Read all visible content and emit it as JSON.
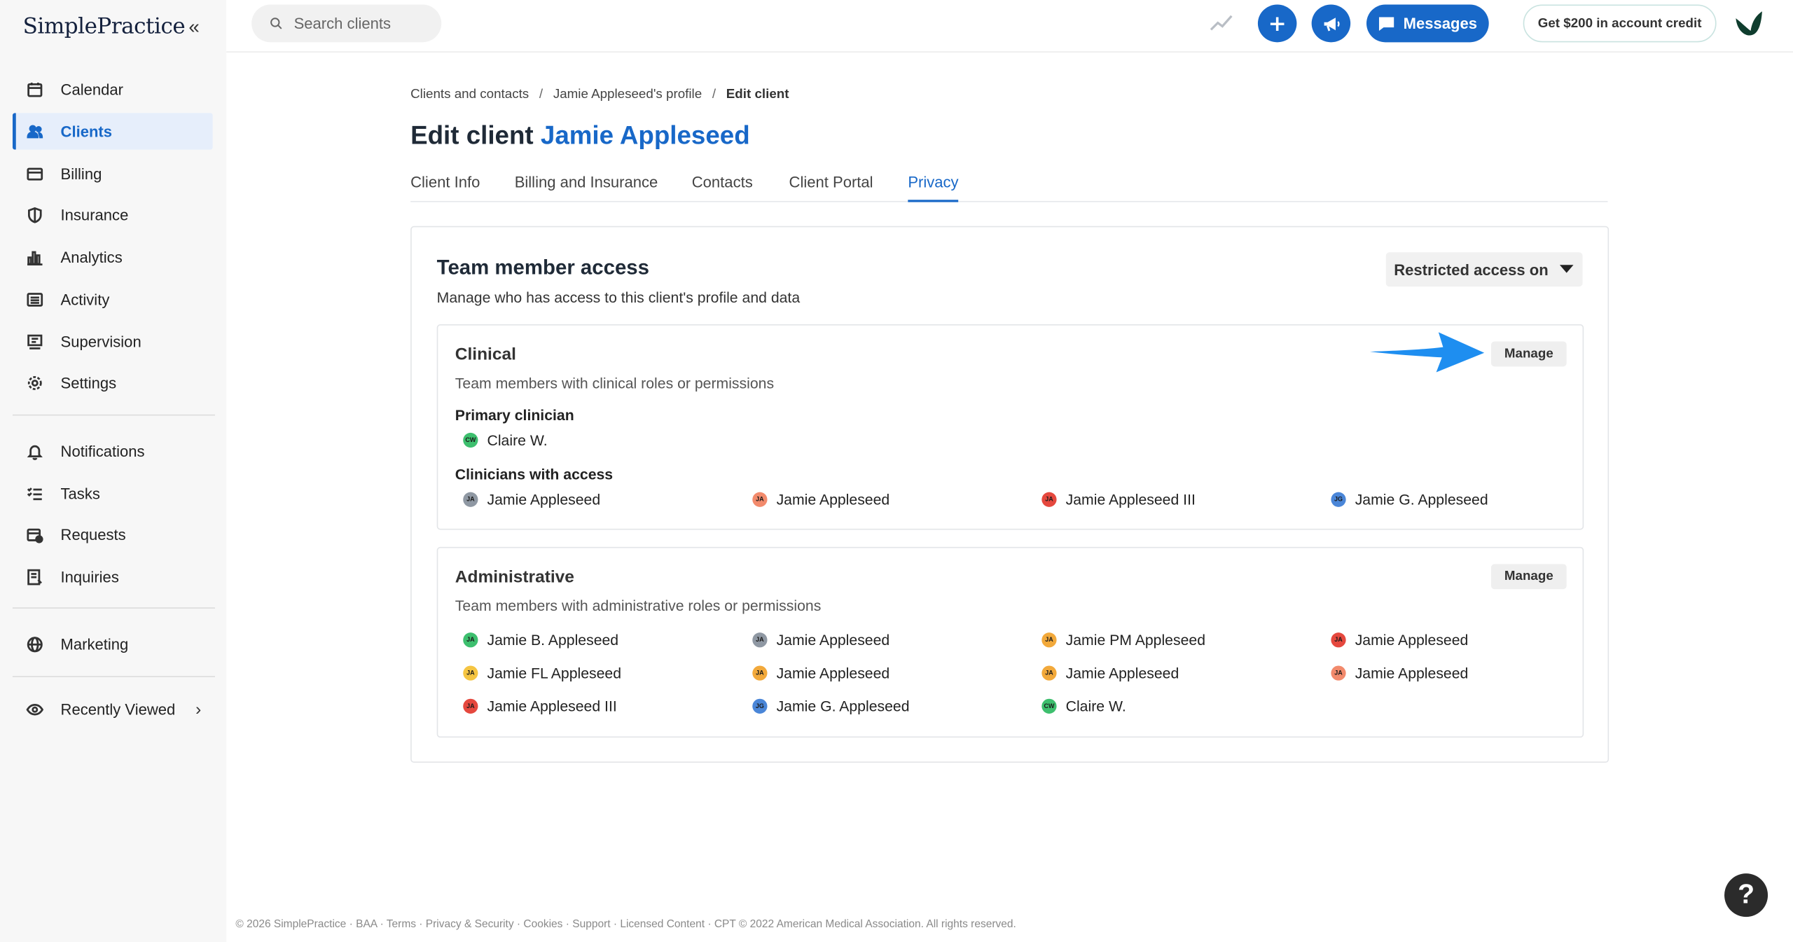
{
  "brand": {
    "logo_text": "SimplePractice"
  },
  "sidebar": {
    "items": [
      {
        "label": "Calendar",
        "icon": "calendar-icon"
      },
      {
        "label": "Clients",
        "icon": "users-icon",
        "active": true
      },
      {
        "label": "Billing",
        "icon": "card-icon"
      },
      {
        "label": "Insurance",
        "icon": "shield-icon"
      },
      {
        "label": "Analytics",
        "icon": "bar-chart-icon"
      },
      {
        "label": "Activity",
        "icon": "list-icon"
      },
      {
        "label": "Supervision",
        "icon": "supervision-icon"
      },
      {
        "label": "Settings",
        "icon": "gear-icon"
      },
      {
        "label": "Notifications",
        "icon": "bell-icon"
      },
      {
        "label": "Tasks",
        "icon": "checklist-icon"
      },
      {
        "label": "Requests",
        "icon": "calendar-plus-icon"
      },
      {
        "label": "Inquiries",
        "icon": "inquiries-icon"
      },
      {
        "label": "Marketing",
        "icon": "globe-icon"
      },
      {
        "label": "Recently Viewed",
        "icon": "eye-icon"
      }
    ]
  },
  "topbar": {
    "search_placeholder": "Search clients",
    "messages_label": "Messages",
    "credit_label": "Get $200 in account credit"
  },
  "breadcrumb": [
    "Clients and contacts",
    "Jamie Appleseed's profile",
    "Edit client"
  ],
  "title": {
    "prefix": "Edit client",
    "client_name": "Jamie Appleseed"
  },
  "tabs": [
    "Client Info",
    "Billing and Insurance",
    "Contacts",
    "Client Portal",
    "Privacy"
  ],
  "team_access": {
    "title": "Team member access",
    "subtitle": "Manage who has access to this client's profile and data",
    "access_mode": "Restricted access on",
    "clinical": {
      "title": "Clinical",
      "subtitle": "Team members with clinical roles or permissions",
      "manage_label": "Manage",
      "primary_heading": "Primary clinician",
      "primary": {
        "initials": "CW",
        "name": "Claire W.",
        "color": "#3dbf6e"
      },
      "access_heading": "Clinicians with access",
      "members": [
        {
          "initials": "JA",
          "name": "Jamie Appleseed",
          "color": "#8f98a3"
        },
        {
          "initials": "JA",
          "name": "Jamie Appleseed",
          "color": "#f28a6c"
        },
        {
          "initials": "JA",
          "name": "Jamie Appleseed III",
          "color": "#e5483e"
        },
        {
          "initials": "JG",
          "name": "Jamie G. Appleseed",
          "color": "#4a86d8"
        }
      ]
    },
    "administrative": {
      "title": "Administrative",
      "subtitle": "Team members with administrative roles or permissions",
      "manage_label": "Manage",
      "members": [
        {
          "initials": "JA",
          "name": "Jamie B. Appleseed",
          "color": "#3dbf6e"
        },
        {
          "initials": "JA",
          "name": "Jamie Appleseed",
          "color": "#8f98a3"
        },
        {
          "initials": "JA",
          "name": "Jamie PM Appleseed",
          "color": "#f2a93b"
        },
        {
          "initials": "JA",
          "name": "Jamie Appleseed",
          "color": "#e5483e"
        },
        {
          "initials": "JA",
          "name": "Jamie FL Appleseed",
          "color": "#f5c542"
        },
        {
          "initials": "JA",
          "name": "Jamie Appleseed",
          "color": "#f2a93b"
        },
        {
          "initials": "JA",
          "name": "Jamie Appleseed",
          "color": "#f2a93b"
        },
        {
          "initials": "JA",
          "name": "Jamie Appleseed",
          "color": "#f28a6c"
        },
        {
          "initials": "JA",
          "name": "Jamie Appleseed III",
          "color": "#e5483e"
        },
        {
          "initials": "JG",
          "name": "Jamie G. Appleseed",
          "color": "#4a86d8"
        },
        {
          "initials": "CW",
          "name": "Claire W.",
          "color": "#3dbf6e"
        }
      ]
    }
  },
  "footer": "© 2026 SimplePractice · BAA · Terms · Privacy & Security · Cookies · Support · Licensed Content · CPT © 2022 American Medical Association. All rights reserved.",
  "help_label": "?",
  "colors": {
    "accent": "#1868c8",
    "arrow": "#1e8ef0"
  }
}
